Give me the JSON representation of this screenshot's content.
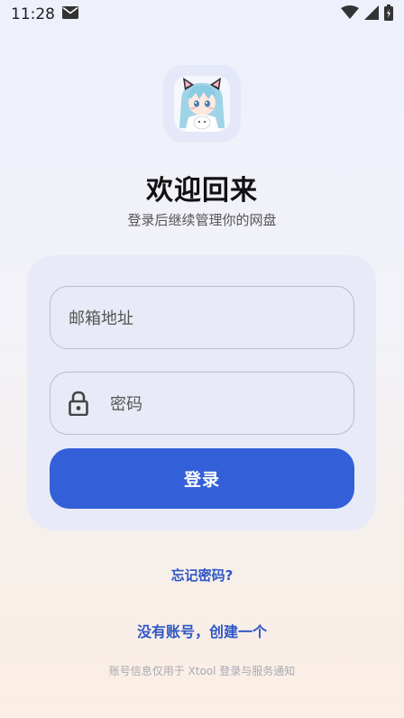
{
  "status_bar": {
    "time": "11:28",
    "icons": [
      "mail-icon",
      "wifi-icon",
      "signal-icon",
      "battery-icon"
    ]
  },
  "header": {
    "title": "欢迎回来",
    "subtitle": "登录后继续管理你的网盘"
  },
  "form": {
    "email_placeholder": "邮箱地址",
    "password_placeholder": "密码",
    "login_label": "登录"
  },
  "links": {
    "forgot_password": "忘记密码?",
    "create_account": "没有账号，创建一个"
  },
  "footer": {
    "notice": "账号信息仅用于 Xtool 登录与服务通知"
  },
  "colors": {
    "accent": "#3360d8",
    "link": "#2e56c6",
    "card_bg": "#e8ebf7"
  }
}
